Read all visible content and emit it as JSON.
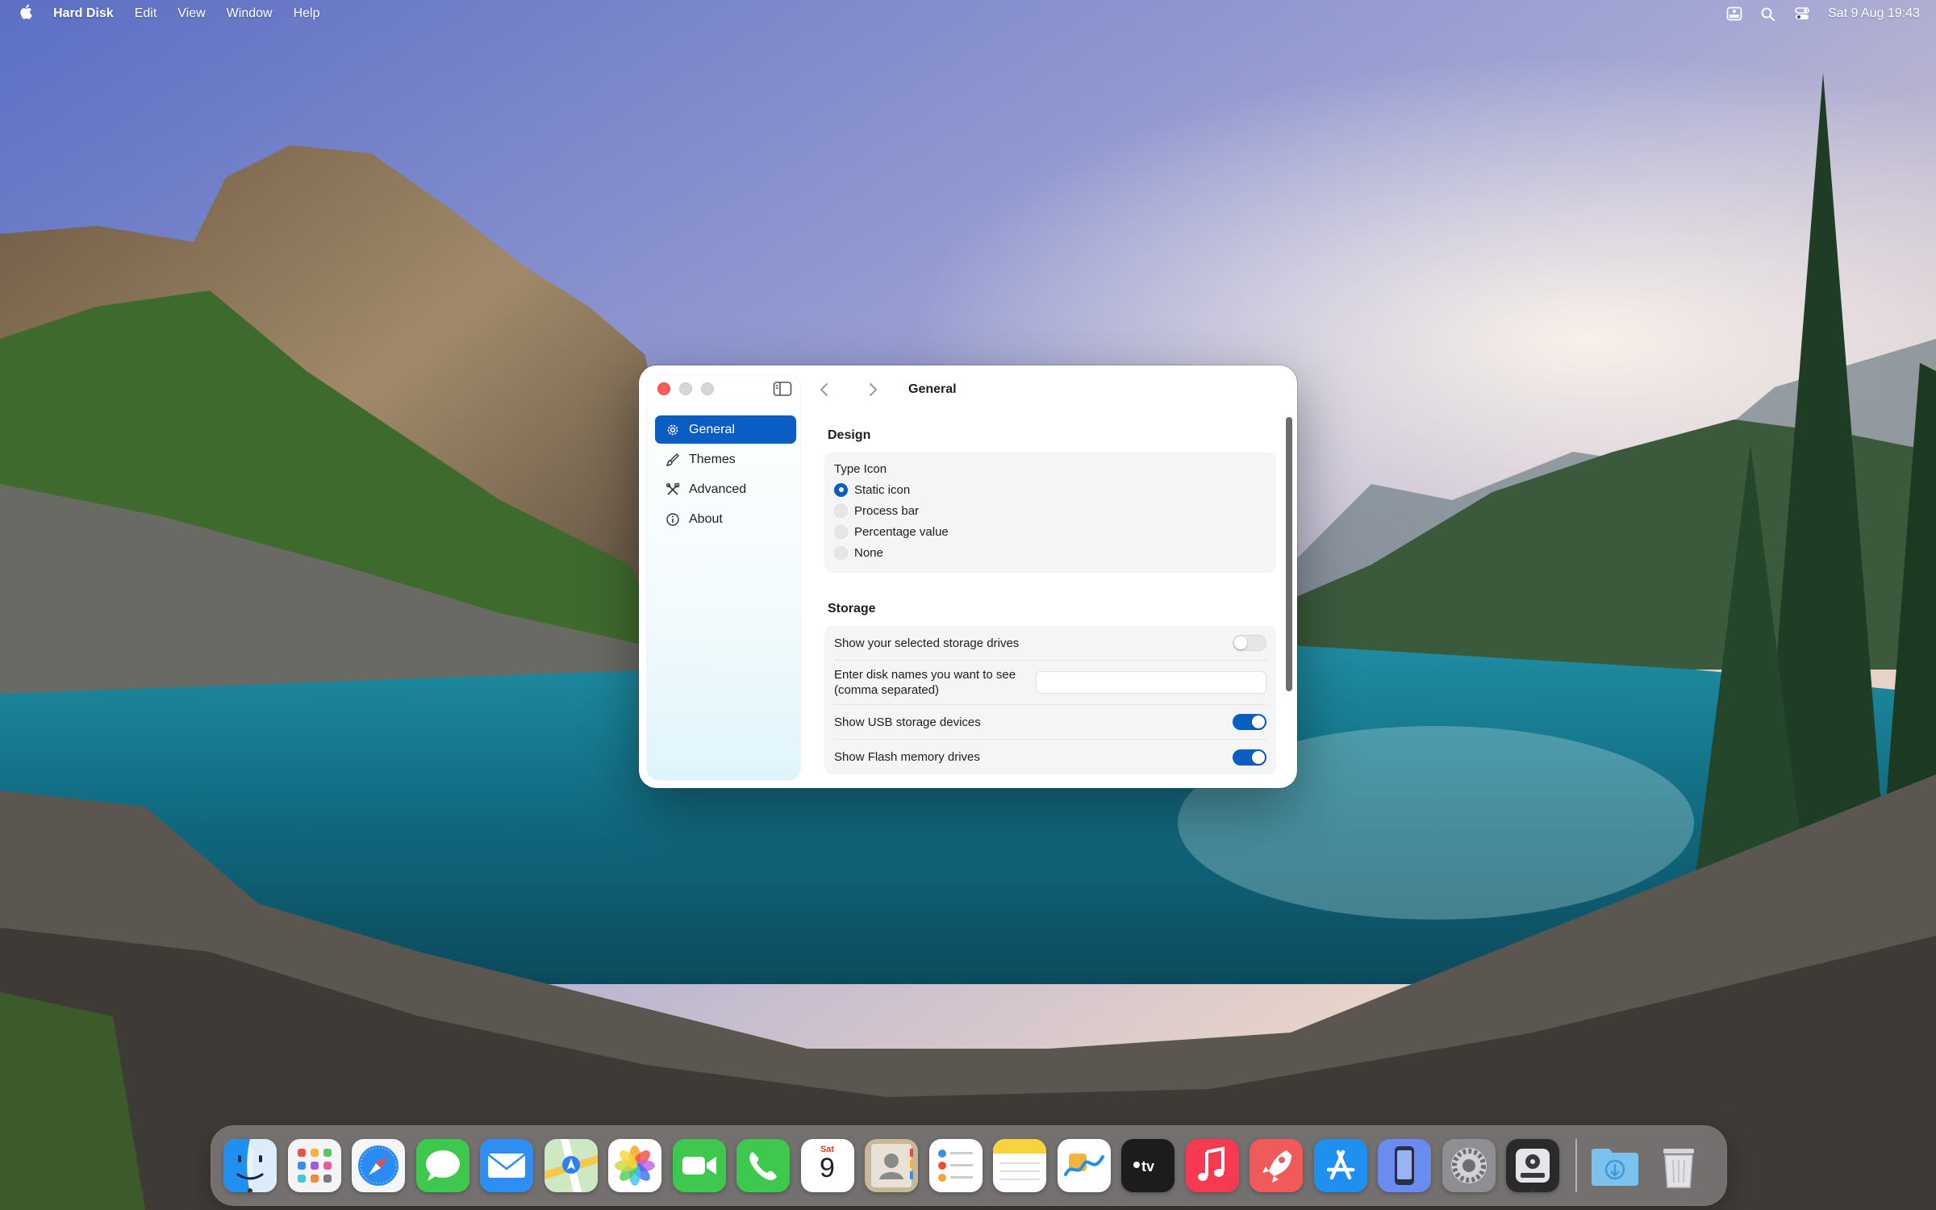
{
  "menubar": {
    "app_name": "Hard Disk",
    "menus": [
      "Edit",
      "View",
      "Window",
      "Help"
    ],
    "clock": "Sat 9 Aug  19:43"
  },
  "window": {
    "toolbar_title": "General",
    "sidebar": [
      {
        "label": "General",
        "icon": "gear-icon",
        "active": true
      },
      {
        "label": "Themes",
        "icon": "brush-icon",
        "active": false
      },
      {
        "label": "Advanced",
        "icon": "tools-icon",
        "active": false
      },
      {
        "label": "About",
        "icon": "info-icon",
        "active": false
      }
    ],
    "design": {
      "title": "Design",
      "group_label": "Type Icon",
      "options": [
        "Static icon",
        "Process bar",
        "Percentage value",
        "None"
      ],
      "selected": "Static icon"
    },
    "storage": {
      "title": "Storage",
      "show_selected_label": "Show your selected storage drives",
      "show_selected_on": false,
      "disk_names_label_1": "Enter disk names you want to see",
      "disk_names_label_2": "(comma separated)",
      "disk_names_value": "",
      "show_usb_label": "Show USB storage devices",
      "show_usb_on": true,
      "show_flash_label": "Show Flash memory drives",
      "show_flash_on": true
    }
  },
  "calendar": {
    "weekday": "Sat",
    "day": "9"
  },
  "dock": [
    "finder-icon",
    "launchpad-icon",
    "safari-icon",
    "messages-icon",
    "mail-icon",
    "maps-icon",
    "photos-icon",
    "facetime-icon",
    "phone-icon",
    "calendar-icon",
    "contacts-icon",
    "reminders-icon",
    "notes-icon",
    "freeform-icon",
    "apple-tv-icon",
    "music-icon",
    "rocket-icon",
    "app-store-icon",
    "simulator-icon",
    "system-settings-icon",
    "hard-disk-icon",
    "downloads-folder-icon",
    "trash-icon"
  ],
  "colors": {
    "accent": "#0a5dc2",
    "close": "#fe5f57"
  }
}
